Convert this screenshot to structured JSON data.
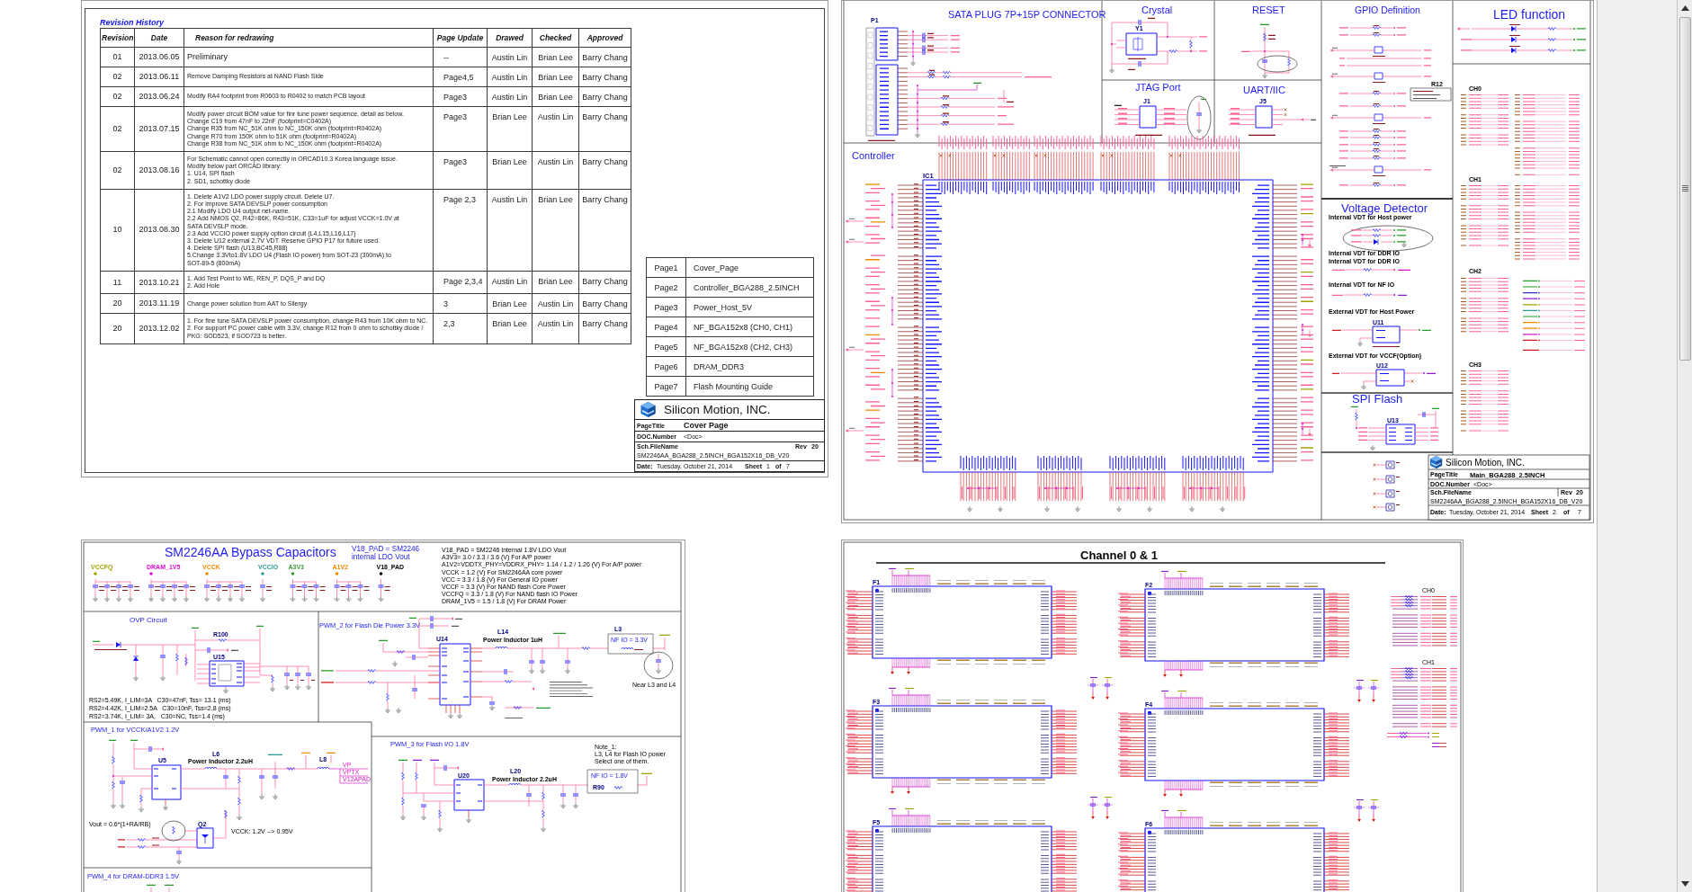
{
  "cover_page": {
    "revision_history": {
      "title": "Revision History",
      "columns": [
        "Revision",
        "Date",
        "Reason for redrawing",
        "Page Update",
        "Drawed",
        "Checked",
        "Approved"
      ],
      "rows": [
        {
          "revision": "01",
          "date": "2013.06.05",
          "reason": "Preliminary",
          "page_update": "--",
          "drawed": "Austin Lin",
          "checked": "Brian Lee",
          "approved": "Barry Chang"
        },
        {
          "revision": "02",
          "date": "2013.06.11",
          "reason": "Remove Damping Resistors at NAND Flash Side",
          "page_update": "Page4,5",
          "drawed": "Austin Lin",
          "checked": "Brian Lee",
          "approved": "Barry Chang"
        },
        {
          "revision": "02",
          "date": "2013.06.24",
          "reason": "Modify RA4 footprint from R0603 to R0402 to match PCB layout",
          "page_update": "Page3",
          "drawed": "Austin Lin",
          "checked": "Brian Lee",
          "approved": "Barry Chang"
        },
        {
          "revision": "02",
          "date": "2013.07.15",
          "reason": "Modify power circuit BOM value for finr tune power sequence, detail as below.\nChange C19 from 47nF to 22nF (footprint=C0402A)\nChange R35 from NC_51K ohm to NC_150K ohm (footprint=R0402A)\nChange R70 from 150K ohm to 51K ohm (footprint=R0402A)\nChange R38 from NC_51K ohm to NC_150K ohm (footprint=R0402A)",
          "page_update": "Page3",
          "drawed": "Brian Lee",
          "checked": "Austin Lin",
          "approved": "Barry Chang"
        },
        {
          "revision": "02",
          "date": "2013.08.16",
          "reason": "For Schematic cannot open correctly in ORCAD10.3 Korea language issue.\nModify below part ORCAD library:\n1. U14, SPI flash\n2. SD1, schottky diode",
          "page_update": "Page3",
          "drawed": "Brian Lee",
          "checked": "Austin Lin",
          "approved": "Barry Chang"
        },
        {
          "revision": "10",
          "date": "2013.08.30",
          "reason": "1. Delete A1V2 LDO power supply circuit. Delete U7.\n2. For improve SATA DEVSLP power consumption\n2.1 Modify LDO U4 output net-name.\n2.2 Add NMOS Q2, R42=86K, R43=51K, C33=1uF for adjust VCCK=1.0V at\nSATA DEVSLP mode.\n2.3 Add VCCIO power supply option circuit (L4,L15,L16,L17)\n3. Delete U12 external 2.7V VDT. Reserve GPIO P17 for future used.\n4. Delete SPI flash (U13,BC45,R88)\n5.Change 3.3Vto1.8V LDO U4 (Flash IO power) from SOT-23 (300mA) to\nSOT-89-5 (800mA)",
          "page_update": "Page 2,3",
          "drawed": "Austin Lin",
          "checked": "Brian Lee",
          "approved": "Barry Chang"
        },
        {
          "revision": "11",
          "date": "2013.10.21",
          "reason": "1. Add Test Point to WE, REN_P, DQS_P and DQ\n2. Add Hole",
          "page_update": "Page 2,3,4",
          "drawed": "Austin Lin",
          "checked": "Brian Lee",
          "approved": "Barry Chang"
        },
        {
          "revision": "20",
          "date": "2013.11.19",
          "reason": "Change power solution from AAT to Silergy",
          "page_update": "3",
          "drawed": "Brian Lee",
          "checked": "Austin Lin",
          "approved": "Barry Chang"
        },
        {
          "revision": "20",
          "date": "2013.12.02",
          "reason": "1. For fine tune SATA DEVSLP power consumption, change R43 from 10K ohm to NC.\n2. For support PC power cable with 3.3V, change R12 from 0 ohm to schottky diode /\nPKG: SOD523, if SOD723 is better.",
          "page_update": "2,3",
          "drawed": "Brian Lee",
          "checked": "Austin Lin",
          "approved": "Barry Chang"
        }
      ]
    },
    "page_index": [
      {
        "page": "Page1",
        "name": "Cover_Page"
      },
      {
        "page": "Page2",
        "name": "Controller_BGA288_2.5INCH"
      },
      {
        "page": "Page3",
        "name": "Power_Host_5V"
      },
      {
        "page": "Page4",
        "name": "NF_BGA152x8 (CH0, CH1)"
      },
      {
        "page": "Page5",
        "name": "NF_BGA152x8 (CH2, CH3)"
      },
      {
        "page": "Page6",
        "name": "DRAM_DDR3"
      },
      {
        "page": "Page7",
        "name": "Flash Mounting Guide"
      }
    ],
    "title_block": {
      "company": "Silicon Motion, INC.",
      "page_title_label": "PageTitle",
      "page_title": "Cover Page",
      "doc_number_label": "DOC.Number",
      "doc_number": "<Doc>",
      "file_name_label": "Sch.FileName",
      "file_name": "SM2246AA_BGA288_2.5INCH_BGA152X16_DB_V20",
      "rev_label": "Rev",
      "rev": "20",
      "date_label": "Date:",
      "date": "Tuesday, October 21, 2014",
      "sheet_label": "Sheet",
      "sheet": "1",
      "of_label": "of",
      "sheet_count": "7"
    }
  },
  "controller_page": {
    "sata": {
      "title": "SATA PLUG 7P+15P CONNECTOR",
      "designator": "P1"
    },
    "crystal": {
      "title": "Crystal",
      "designator": "Y1"
    },
    "reset": {
      "title": "RESET"
    },
    "jtag": {
      "title": "JTAG Port",
      "designator": "J1"
    },
    "uart": {
      "title": "UART/IIC",
      "designator": "J5"
    },
    "controller": {
      "title": "Controller",
      "designator": "IC1"
    },
    "gpio": {
      "title": "GPIO Definition",
      "designator": "R12"
    },
    "led": {
      "title": "LED function"
    },
    "channels": [
      "CH0",
      "CH1",
      "CH2",
      "CH3"
    ],
    "voltage_detector": {
      "title": "Voltage Detector",
      "headings": [
        "Internal VDT for Host power",
        "Internal VDT for DDR IO",
        "Internal VDT for DDR IO",
        "Internal VDT for NF IO",
        "External VDT for Host Power",
        "External VDT for VCCF(Option)"
      ],
      "designators": [
        "U11",
        "U12"
      ]
    },
    "spi_flash": {
      "title": "SPI Flash",
      "designator": "U13"
    },
    "title_block": {
      "company": "Silicon Motion, INC.",
      "page_title_label": "PageTitle",
      "page_title": "Main_BGA288_2.5INCH",
      "doc_number_label": "DOC.Number",
      "doc_number": "<Doc>",
      "file_name_label": "Sch.FileName",
      "file_name": "SM2246AA_BGA288_2.5INCH_BGA152X16_DB_V20",
      "rev_label": "Rev",
      "rev": "20",
      "date_label": "Date:",
      "date": "Tuesday, October 21, 2014",
      "sheet_label": "Sheet",
      "sheet": "2",
      "of_label": "of",
      "sheet_count": "7"
    }
  },
  "power_page": {
    "bypass": {
      "title": "SM2246AA Bypass Capacitors",
      "ldo_note": [
        "V18_PAD = SM2246",
        "internal LDO Vout"
      ],
      "nets": [
        {
          "name": "VCCFQ",
          "color": "#a3a300"
        },
        {
          "name": "DRAM_1V5",
          "color": "#e010d0"
        },
        {
          "name": "VCCK",
          "color": "#f08a00"
        },
        {
          "name": "VCCIO",
          "color": "#2a9a9a"
        },
        {
          "name": "A3V3",
          "color": "#3a9a3a"
        },
        {
          "name": "A1V2",
          "color": "#f08a00"
        },
        {
          "name": "V18_PAD",
          "color": "#000000"
        }
      ],
      "notes": [
        "V18_PAD = SM2246 Internal 1.8V LDO Vout",
        "A3V3= 3.0 / 3.3 / 3.6 (V) For A/P power",
        "A1V2=VDDTX_PHY=VDDRX_PHY= 1.14 / 1.2 / 1.26 (V) For A/P power",
        "VCCK = 1.2 (V) For SM2246AA core power",
        "VCC = 3.3 / 1.8 (V) For General IO power",
        "VCCF = 3.3 (V) For NAND flash Core Power",
        "VCCFQ = 3.3 / 1.8 (V) For NAND flash IO Power",
        "DRAM_1V5 = 1.5 / 1.8 (V) For DRAM Power"
      ]
    },
    "ovp": {
      "title": "OVP Circuit",
      "designators": [
        "R100",
        "U15"
      ],
      "notes": [
        "RS2=5.49K, I_LIM=3A   C30=47nF, Tss= 13.1 (ms)",
        "RS2=4.42K, I_LIM=2.5A   C30=10nF, Tss=2.8 (ms)",
        "RS2=3.74K, I_LIM= 3A,   C30=NC, Tss=1.4 (ms)"
      ]
    },
    "pwm2": {
      "title": "PWM_2 for Flash Die Power 3.3V",
      "designators": [
        "U14",
        "L14"
      ],
      "inductor": "Power Inductor 1uH",
      "nf_io": "NF IO = 3.3V",
      "coil": "L3",
      "near": "Near L3 and L4"
    },
    "pwm1": {
      "title": "PWM_1 for VCCK/A1V2 1.2V",
      "designators": [
        "U5",
        "L6",
        "L8",
        "Q2"
      ],
      "inductor": "Power Inductor 2.2uH",
      "formula": "Vout = 0.6*(1+RA/RB)",
      "vcck_note": "VCCK: 1.2V --> 0.95V",
      "outputs": [
        "VP",
        "VPTX",
        "V12APAD"
      ]
    },
    "pwm3": {
      "title": "PWM_3 for Flash I/O 1.8V",
      "designators": [
        "U20",
        "L20",
        "R90"
      ],
      "inductor": "Power Inductor 2.2uH",
      "nf_io": "NF IO = 1.8V",
      "note": [
        "Note_1:",
        "L3, L4 for Flash IO power",
        "Select one of them."
      ]
    },
    "pwm4": {
      "title": "PWM_4 for DRAM-DDR3 1.5V"
    }
  },
  "flash_page": {
    "title": "Channel 0 & 1",
    "chips": [
      "F1",
      "F2",
      "F3",
      "F4",
      "F5",
      "F6"
    ],
    "channels": [
      "CH0",
      "CH1"
    ]
  }
}
